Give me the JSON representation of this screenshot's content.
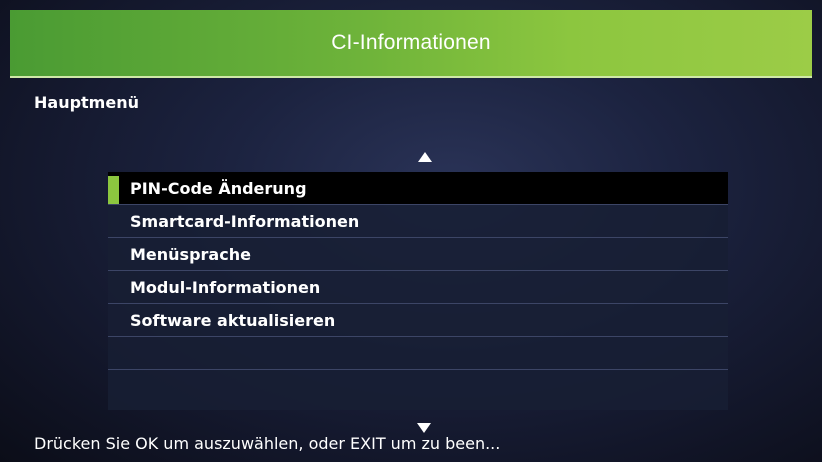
{
  "header": {
    "title": "CI-Informationen",
    "accent_color": "#8cc63f"
  },
  "breadcrumb": {
    "label": "Hauptmenü"
  },
  "menu": {
    "items": [
      {
        "label": "PIN-Code Änderung",
        "selected": true
      },
      {
        "label": "Smartcard-Informationen",
        "selected": false
      },
      {
        "label": "Menüsprache",
        "selected": false
      },
      {
        "label": "Modul-Informationen",
        "selected": false
      },
      {
        "label": "Software aktualisieren",
        "selected": false
      },
      {
        "label": "",
        "selected": false
      },
      {
        "label": "",
        "selected": false
      }
    ],
    "scroll_up_icon": "arrow-up-icon",
    "scroll_down_icon": "arrow-down-icon"
  },
  "footer": {
    "help_text": "Drücken Sie OK um auszuwählen, oder EXIT um zu been..."
  }
}
